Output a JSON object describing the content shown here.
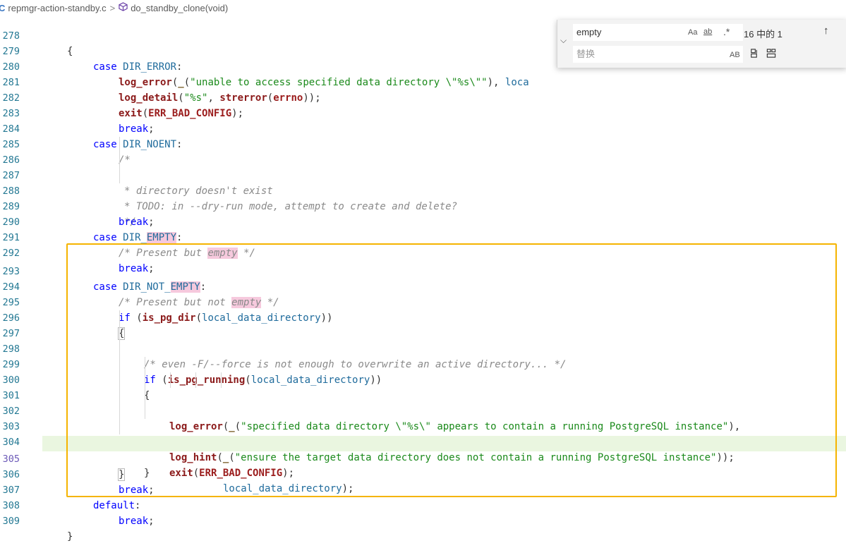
{
  "breadcrumb": {
    "file_icon": "C",
    "file": "repmgr-action-standby.c",
    "separator": ">",
    "symbol_icon": "function-cube-icon",
    "symbol": "do_standby_clone(void)"
  },
  "find_widget": {
    "find_value": "empty",
    "replace_placeholder": "替换",
    "match_case_label": "Aa",
    "whole_word_label": "ab",
    "regex_label": ".*",
    "result_count": "16 中的 1",
    "preserve_case_label": "AB",
    "up_arrow": "↑",
    "toggle_arrow": "⌵"
  },
  "editor": {
    "line_numbers": [
      "278",
      "279",
      "280",
      "281",
      "282",
      "283",
      "284",
      "285",
      "286",
      "287",
      "288",
      "289",
      "290",
      "291",
      "292",
      "293",
      "294",
      "295",
      "296",
      "297",
      "298",
      "299",
      "300",
      "301",
      "302",
      "303",
      "304",
      "305",
      "306",
      "307",
      "308",
      "309"
    ],
    "current_line": "305"
  },
  "colors": {
    "selection_box": "#f5b400",
    "current_line_bg": "#eaf6e0",
    "match_highlight": "#f6c9dd"
  }
}
